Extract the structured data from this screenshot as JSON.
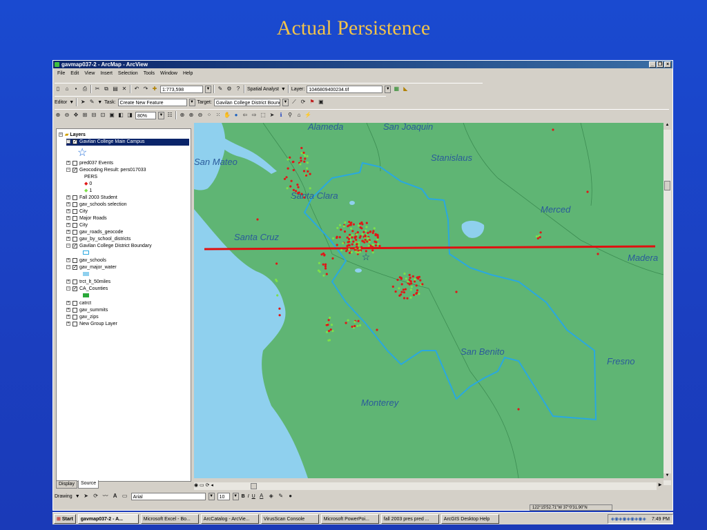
{
  "slide": {
    "title": "Actual Persistence"
  },
  "window": {
    "title": "gavmap037-2 - ArcMap - ArcView"
  },
  "menu": [
    "File",
    "Edit",
    "View",
    "Insert",
    "Selection",
    "Tools",
    "Window",
    "Help"
  ],
  "toolbar1": {
    "scale": "1:773,598",
    "spatial_analyst": "Spatial Analyst",
    "layer_label": "Layer:",
    "layer_value": "1046809400234.tif"
  },
  "toolbar2": {
    "editor": "Editor",
    "task_label": "Task:",
    "task_value": "Create New Feature",
    "target_label": "Target:",
    "target_value": "Gavilan College District Boundar"
  },
  "toolbar3": {
    "zoom": "80%"
  },
  "toc": {
    "root": "Layers",
    "items": [
      "Gavilan College Main Campus",
      "pred037 Events",
      "Geocoding Result: pers017033",
      "PERS",
      "0",
      "1",
      "Fall 2003 Student",
      "gav_schools selection",
      "City",
      "Major Roads",
      "City",
      "gav_roads_geocode",
      "gav_by_school_districts",
      "Gavilan College District Boundary",
      "gav_schools",
      "gav_major_water",
      "trct_lt_50miles",
      "CA_Counties",
      "catrct",
      "gav_summits",
      "gav_zips",
      "New Group Layer"
    ]
  },
  "tabs": {
    "display": "Display",
    "source": "Source"
  },
  "map": {
    "labels": [
      "Alameda",
      "San Joaquin",
      "Stanislaus",
      "San Mateo",
      "Santa Clara",
      "Merced",
      "Santa Cruz",
      "Madera",
      "San Benito",
      "Fresno",
      "Monterey"
    ],
    "colors": {
      "land": "#5fb574",
      "water": "#8fd0ee",
      "boundary": "#29a8e0",
      "line": "#e01010",
      "points_red": "#e01818",
      "points_green": "#7ee04a"
    }
  },
  "drawing": {
    "label": "Drawing",
    "font": "Arial",
    "size": "10",
    "bold": "B",
    "italic": "I",
    "underline": "U"
  },
  "status": {
    "coords": "122°15'52.71\"W  37°0'31.90\"N"
  },
  "taskbar": {
    "start": "Start",
    "items": [
      "gavmap037-2 - A...",
      "Microsoft Excel - Bo...",
      "ArcCatalog - ArcVie...",
      "VirusScan Console",
      "Microsoft PowerPoi...",
      "fall 2003 pres pred ...",
      "ArcGIS Desktop Help"
    ],
    "time": "7:49 PM"
  }
}
